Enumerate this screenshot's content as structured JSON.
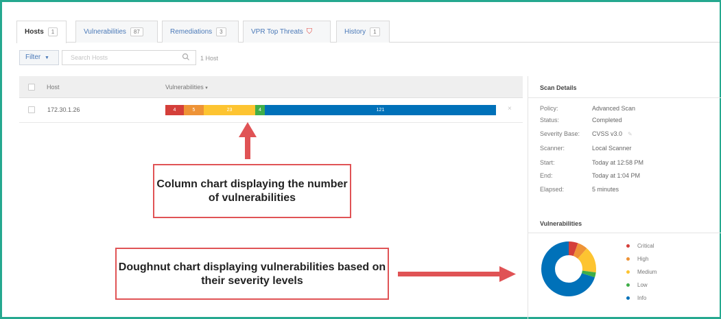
{
  "tabs": [
    {
      "label": "Hosts",
      "count": "1",
      "active": true
    },
    {
      "label": "Vulnerabilities",
      "count": "87",
      "active": false
    },
    {
      "label": "Remediations",
      "count": "3",
      "active": false
    },
    {
      "label": "VPR Top Threats",
      "icon": "shield-icon",
      "active": false
    },
    {
      "label": "History",
      "count": "1",
      "active": false
    }
  ],
  "filter": {
    "label": "Filter",
    "search_placeholder": "Search Hosts",
    "host_count": "1 Host"
  },
  "table": {
    "columns": [
      "Host",
      "Vulnerabilities"
    ],
    "sort_indicator": "▾",
    "rows": [
      {
        "host": "172.30.1.26",
        "segments": [
          {
            "severity": "Critical",
            "label": "4",
            "share": 0.055,
            "color": "#d43f3a"
          },
          {
            "severity": "High",
            "label": "5",
            "share": 0.06,
            "color": "#ee9336"
          },
          {
            "severity": "Medium",
            "label": "23",
            "share": 0.155,
            "color": "#fdc431"
          },
          {
            "severity": "Low",
            "label": "4",
            "share": 0.03,
            "color": "#3fae49"
          },
          {
            "severity": "Info",
            "label": "121",
            "share": 0.7,
            "color": "#0071b9"
          }
        ],
        "remove_icon": "×"
      }
    ]
  },
  "scan_details": {
    "title": "Scan Details",
    "items": [
      {
        "key": "Policy:",
        "value": "Advanced Scan"
      },
      {
        "key": "Status:",
        "value": "Completed"
      },
      {
        "key": "Severity Base:",
        "value": "CVSS v3.0"
      },
      {
        "key": "Scanner:",
        "value": "Local Scanner"
      },
      {
        "key": "Start:",
        "value": "Today at 12:58 PM"
      },
      {
        "key": "End:",
        "value": "Today at 1:04 PM"
      },
      {
        "key": "Elapsed:",
        "value": "5 minutes"
      }
    ]
  },
  "vuln_panel": {
    "title": "Vulnerabilities",
    "legend": [
      {
        "label": "Critical",
        "color": "#d43f3a"
      },
      {
        "label": "High",
        "color": "#ee9336"
      },
      {
        "label": "Medium",
        "color": "#fdc431"
      },
      {
        "label": "Low",
        "color": "#3fae49"
      },
      {
        "label": "Info",
        "color": "#0071b9"
      }
    ],
    "donut_shares": [
      0.055,
      0.06,
      0.155,
      0.03,
      0.7
    ]
  },
  "annotations": {
    "column_chart": "Column chart displaying the number of vulnerabilities",
    "doughnut_chart": "Doughnut chart displaying vulnerabilities based on their severity levels",
    "arrow_color": "#e05355"
  }
}
